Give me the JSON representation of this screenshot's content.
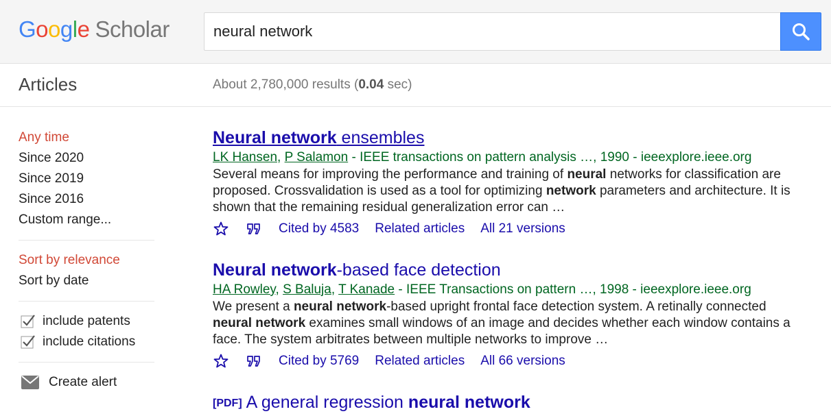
{
  "header": {
    "logo": {
      "g1": "G",
      "g2": "o",
      "g3": "o",
      "g4": "g",
      "g5": "l",
      "g6": "e",
      "product": "Scholar"
    },
    "search": {
      "value": "neural network"
    },
    "search_button_icon": "search-icon"
  },
  "subbar": {
    "section_label": "Articles",
    "results_prefix": "About 2,780,000 results (",
    "results_time": "0.04",
    "results_suffix": " sec)"
  },
  "sidebar": {
    "time_filters": [
      "Any time",
      "Since 2020",
      "Since 2019",
      "Since 2016",
      "Custom range..."
    ],
    "sort_options": [
      "Sort by relevance",
      "Sort by date"
    ],
    "checkboxes": [
      {
        "label": "include patents",
        "checked": true
      },
      {
        "label": "include citations",
        "checked": true
      }
    ],
    "alert_label": "Create alert"
  },
  "results": [
    {
      "title_bold": "Neural network",
      "title_rest": " ensembles",
      "author1": "LK Hansen",
      "sep1": ", ",
      "author2": "P Salamon",
      "source": " - IEEE transactions on pattern analysis …, 1990 - ieeexplore.ieee.org",
      "snippet": {
        "s1": "Several means for improving the performance and training of ",
        "b1": "neural",
        "s2": " networks for classification are proposed. Crossvalidation is used as a tool for optimizing ",
        "b2": "network",
        "s3": " parameters and architecture. It is shown that the remaining residual generalization error can …"
      },
      "cited_by": "Cited by 4583",
      "related": "Related articles",
      "versions": "All 21 versions"
    },
    {
      "title_bold": "Neural network",
      "title_rest": "-based face detection",
      "author1": "HA Rowley",
      "sep1": ", ",
      "author2": "S Baluja",
      "sep2": ", ",
      "author3": "T Kanade",
      "source": " - IEEE Transactions on pattern …, 1998 - ieeexplore.ieee.org",
      "snippet": {
        "s1": "We present a ",
        "b1": "neural network",
        "s2": "-based upright frontal face detection system. A retinally connected ",
        "b2": "neural network",
        "s3": " examines small windows of an image and decides whether each window contains a face. The system arbitrates between multiple networks to improve …"
      },
      "cited_by": "Cited by 5769",
      "related": "Related articles",
      "versions": "All 66 versions"
    },
    {
      "pdf_tag": "[PDF]",
      "title_rest": "A general regression ",
      "title_bold": "neural network"
    }
  ],
  "colors": {
    "link": "#1a0dab",
    "active_filter": "#d14836",
    "author_green": "#006621",
    "search_button": "#4d90fe"
  }
}
